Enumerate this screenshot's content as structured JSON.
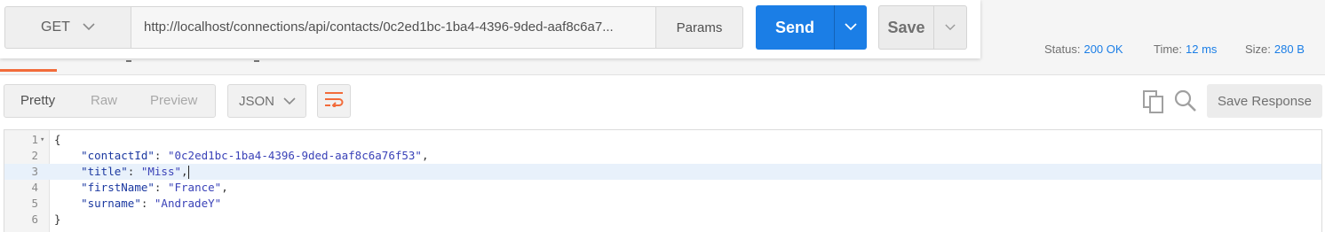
{
  "request": {
    "method": "GET",
    "url": "http://localhost/connections/api/contacts/0c2ed1bc-1ba4-4396-9ded-aaf8c6a7...",
    "params_label": "Params",
    "send_label": "Send",
    "save_label": "Save"
  },
  "response_status": {
    "status_label": "Status:",
    "status_value": "200 OK",
    "time_label": "Time:",
    "time_value": "12 ms",
    "size_label": "Size:",
    "size_value": "280 B"
  },
  "response_toolbar": {
    "view_tabs": [
      "Pretty",
      "Raw",
      "Preview"
    ],
    "active_view": "Pretty",
    "format": "JSON",
    "save_response_label": "Save Response"
  },
  "body": {
    "line_numbers": [
      "1",
      "2",
      "3",
      "4",
      "5",
      "6"
    ],
    "lines": [
      {
        "tokens": [
          {
            "t": "{",
            "c": "p"
          }
        ]
      },
      {
        "tokens": [
          {
            "t": "    ",
            "c": "p"
          },
          {
            "t": "\"contactId\"",
            "c": "k"
          },
          {
            "t": ": ",
            "c": "p"
          },
          {
            "t": "\"0c2ed1bc-1ba4-4396-9ded-aaf8c6a76f53\"",
            "c": "s"
          },
          {
            "t": ",",
            "c": "p"
          }
        ]
      },
      {
        "tokens": [
          {
            "t": "    ",
            "c": "p"
          },
          {
            "t": "\"title\"",
            "c": "k"
          },
          {
            "t": ": ",
            "c": "p"
          },
          {
            "t": "\"Miss\"",
            "c": "s"
          },
          {
            "t": ",",
            "c": "p"
          }
        ]
      },
      {
        "tokens": [
          {
            "t": "    ",
            "c": "p"
          },
          {
            "t": "\"firstName\"",
            "c": "k"
          },
          {
            "t": ": ",
            "c": "p"
          },
          {
            "t": "\"France\"",
            "c": "s"
          },
          {
            "t": ",",
            "c": "p"
          }
        ]
      },
      {
        "tokens": [
          {
            "t": "    ",
            "c": "p"
          },
          {
            "t": "\"surname\"",
            "c": "k"
          },
          {
            "t": ": ",
            "c": "p"
          },
          {
            "t": "\"AndradeY\"",
            "c": "s"
          }
        ]
      },
      {
        "tokens": [
          {
            "t": "}",
            "c": "p"
          }
        ]
      }
    ],
    "highlighted_line": 3
  },
  "colors": {
    "accent_blue": "#1b7ee6",
    "tab_underline": "#f26b3a",
    "status_value": "#1b7ee6"
  },
  "icons": {
    "method_dropdown": "chevron-down-icon",
    "send_dropdown": "chevron-down-icon",
    "save_dropdown": "chevron-down-icon",
    "format_dropdown": "chevron-down-icon",
    "wrap": "wrap-lines-icon",
    "copy": "copy-icon",
    "search": "search-icon",
    "fold": "fold-arrow-icon"
  }
}
